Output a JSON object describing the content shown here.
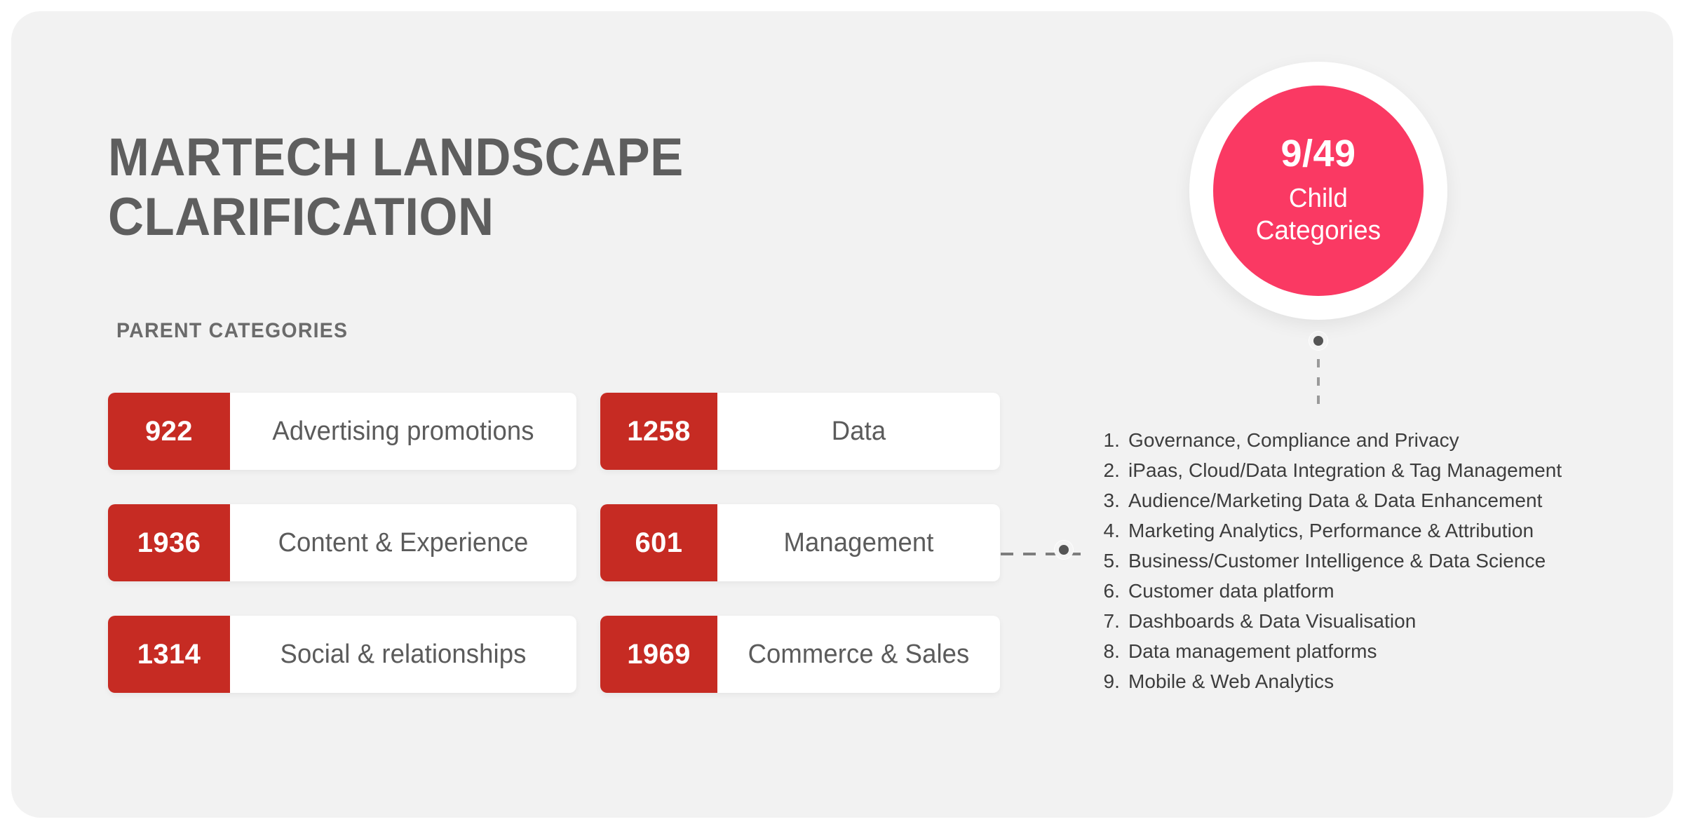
{
  "header": {
    "title": "MARTECH LANDSCAPE\nCLARIFICATION",
    "subtitle": "PARENT CATEGORIES"
  },
  "colors": {
    "background": "#ffffff",
    "card": "#f2f2f2",
    "red": "#c62b23",
    "pink": "#fa3963",
    "title_gray": "#5e5e5e",
    "body_gray": "#3d3d3d",
    "connector_gray": "#555555"
  },
  "parent_categories": {
    "left_column": [
      {
        "count": "922",
        "label": "Advertising promotions"
      },
      {
        "count": "1936",
        "label": "Content & Experience"
      },
      {
        "count": "1314",
        "label": "Social & relationships"
      }
    ],
    "right_column": [
      {
        "count": "1258",
        "label": "Data"
      },
      {
        "count": "601",
        "label": "Management"
      },
      {
        "count": "1969",
        "label": "Commerce & Sales"
      }
    ]
  },
  "badge": {
    "number": "9/49",
    "caption": "Child\nCategories"
  },
  "child_categories": [
    {
      "number": "1.",
      "label": "Governance, Compliance and Privacy"
    },
    {
      "number": "2.",
      "label": "iPaas, Cloud/Data Integration & Tag Management"
    },
    {
      "number": "3.",
      "label": "Audience/Marketing Data & Data Enhancement"
    },
    {
      "number": "4.",
      "label": "Marketing Analytics, Performance & Attribution"
    },
    {
      "number": "5.",
      "label": "Business/Customer Intelligence & Data Science"
    },
    {
      "number": "6.",
      "label": "Customer data platform"
    },
    {
      "number": "7.",
      "label": "Dashboards & Data Visualisation"
    },
    {
      "number": "8.",
      "label": "Data management platforms"
    },
    {
      "number": "9.",
      "label": "Mobile & Web Analytics"
    }
  ]
}
